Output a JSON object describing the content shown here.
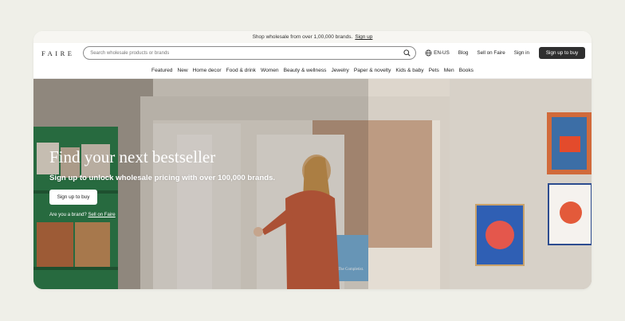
{
  "promo": {
    "text": "Shop wholesale from over 1,00,000 brands.",
    "link": "Sign up"
  },
  "header": {
    "logo": "FAIRE",
    "search_placeholder": "Search wholesale products or brands",
    "locale": "EN-US",
    "blog": "Blog",
    "sell": "Sell on Faire",
    "signin": "Sign in",
    "signup": "Sign up to buy"
  },
  "categories": [
    "Featured",
    "New",
    "Home decor",
    "Food & drink",
    "Women",
    "Beauty & wellness",
    "Jewelry",
    "Paper & novelty",
    "Kids & baby",
    "Pets",
    "Men",
    "Books"
  ],
  "hero": {
    "title": "Find your next bestseller",
    "subtitle": "Sign up to unlock wholesale pricing with over 100,000 brands.",
    "cta": "Sign up to buy",
    "brand_prompt": "Are you a brand?",
    "brand_link": "Sell on Faire",
    "sign_text": "The Completist."
  },
  "colors": {
    "page_bg": "#efefe8",
    "button_dark": "#2f2f2f",
    "promo_bg": "#f7f6f2"
  }
}
